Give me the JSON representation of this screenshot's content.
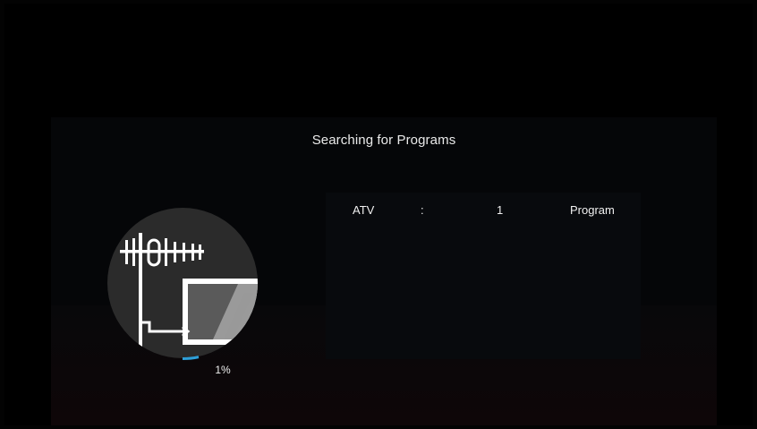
{
  "dialog": {
    "title": "Searching for Programs"
  },
  "results": [
    {
      "type": "ATV",
      "separator": ":",
      "count": "1",
      "unit": "Program"
    }
  ],
  "progress": {
    "label": "1%",
    "value_percent": 1
  },
  "icons": {
    "search_graphic": "antenna-tv-icon"
  },
  "colors": {
    "background": "#000000",
    "progress_arc": "#2e9fd8",
    "icon_circle": "#2a2a2a",
    "text": "#f0f0f0"
  }
}
